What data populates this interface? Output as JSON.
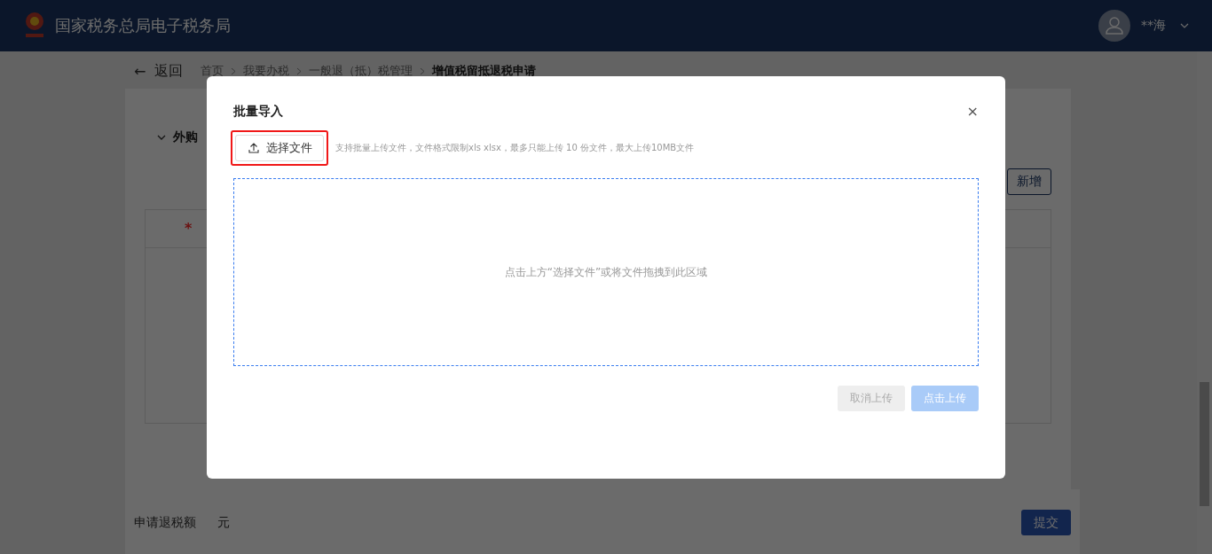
{
  "header": {
    "title": "国家税务总局电子税务局",
    "user": "**海"
  },
  "back": {
    "label": "返回",
    "arrow": "←"
  },
  "breadcrumb": [
    {
      "label": "首页",
      "current": false
    },
    {
      "label": "我要办税",
      "current": false
    },
    {
      "label": "一般退（抵）税管理",
      "current": false
    },
    {
      "label": "增值税留抵退税申请",
      "current": true
    }
  ],
  "section": {
    "title": "外购",
    "expanded": true,
    "add_button": "新增",
    "required_mark": "*"
  },
  "footer": {
    "label": "申请退税额",
    "unit": "元",
    "submit": "提交"
  },
  "dialog": {
    "title": "批量导入",
    "close": "×",
    "select_button": {
      "label": "选择文件",
      "highlighted": true
    },
    "hint": "支持批量上传文件，文件格式限制xls xlsx，最多只能上传 10 份文件，最大上传10MB文件",
    "dropzone": "点击上方“选择文件”或将文件拖拽到此区域",
    "buttons": [
      {
        "label": "取消上传",
        "kind": "cancel",
        "disabled": true
      },
      {
        "label": "点击上传",
        "kind": "primary",
        "disabled": true
      }
    ]
  }
}
